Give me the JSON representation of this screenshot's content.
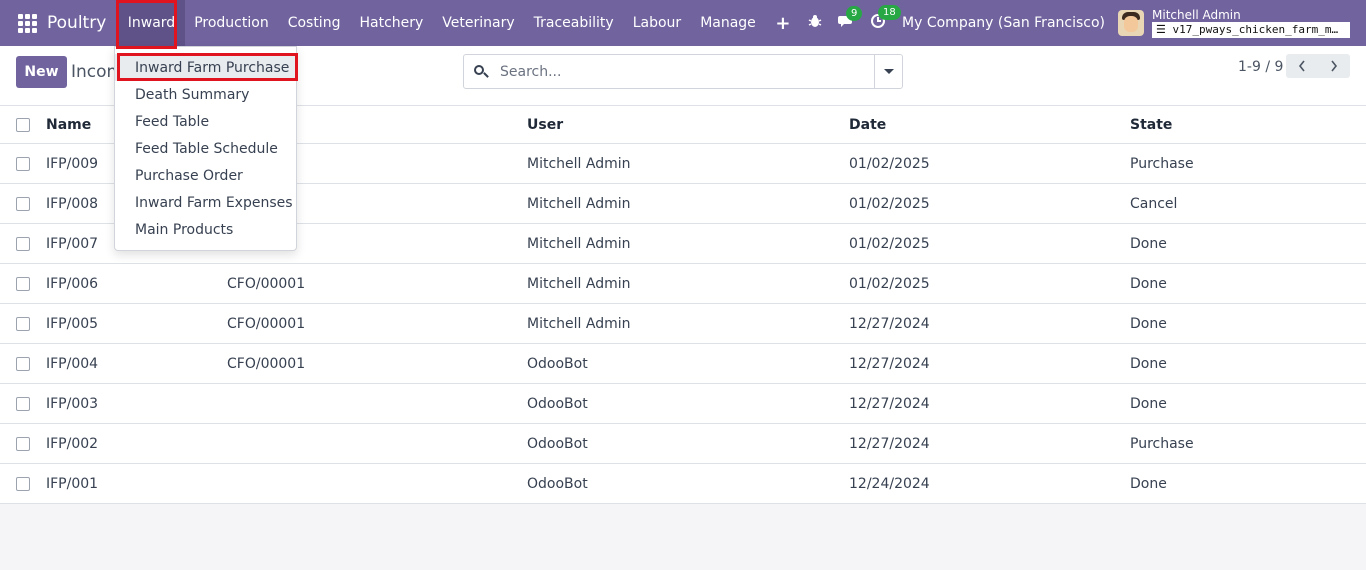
{
  "navbar": {
    "app_name": "Poultry",
    "menu": [
      "Inward",
      "Production",
      "Costing",
      "Hatchery",
      "Veterinary",
      "Traceability",
      "Labour",
      "Manage"
    ],
    "plus": "+",
    "messages_count": "9",
    "activities_count": "18",
    "company": "My Company (San Francisco)",
    "user_name": "Mitchell Admin",
    "database": "v17_pways_chicken_farm_m…"
  },
  "control": {
    "new_label": "New",
    "breadcrumb": "Incom",
    "search_placeholder": "Search...",
    "pager": "1-9 / 9"
  },
  "dropdown": {
    "items": [
      "Inward Farm Purchase",
      "Death Summary",
      "Feed Table",
      "Feed Table Schedule",
      "Purchase Order",
      "Inward Farm Expenses",
      "Main Products"
    ]
  },
  "table": {
    "headers": {
      "name": "Name",
      "ref": "e",
      "user": "User",
      "date": "Date",
      "state": "State"
    },
    "rows": [
      {
        "name": "IFP/009",
        "ref": "",
        "user": "Mitchell Admin",
        "date": "01/02/2025",
        "state": "Purchase"
      },
      {
        "name": "IFP/008",
        "ref": "",
        "user": "Mitchell Admin",
        "date": "01/02/2025",
        "state": "Cancel"
      },
      {
        "name": "IFP/007",
        "ref": "",
        "user": "Mitchell Admin",
        "date": "01/02/2025",
        "state": "Done"
      },
      {
        "name": "IFP/006",
        "ref": "CFO/00001",
        "user": "Mitchell Admin",
        "date": "01/02/2025",
        "state": "Done"
      },
      {
        "name": "IFP/005",
        "ref": "CFO/00001",
        "user": "Mitchell Admin",
        "date": "12/27/2024",
        "state": "Done"
      },
      {
        "name": "IFP/004",
        "ref": "CFO/00001",
        "user": "OdooBot",
        "date": "12/27/2024",
        "state": "Done"
      },
      {
        "name": "IFP/003",
        "ref": "",
        "user": "OdooBot",
        "date": "12/27/2024",
        "state": "Done"
      },
      {
        "name": "IFP/002",
        "ref": "",
        "user": "OdooBot",
        "date": "12/27/2024",
        "state": "Purchase"
      },
      {
        "name": "IFP/001",
        "ref": "",
        "user": "OdooBot",
        "date": "12/24/2024",
        "state": "Done"
      }
    ]
  },
  "colors": {
    "brand": "#71639e",
    "highlight": "#e0141e",
    "badge": "#28a745"
  }
}
